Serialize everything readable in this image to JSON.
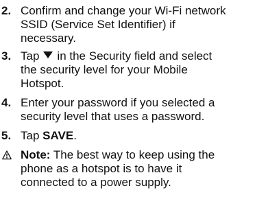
{
  "steps": [
    {
      "number": "2.",
      "lines": [
        "Confirm and change your Wi-Fi network",
        "SSID (Service Set Identifier) if",
        "necessary."
      ]
    },
    {
      "number": "3.",
      "before_icon": "Tap",
      "icon": "dropdown-triangle-icon",
      "after_icon": "in the Security field and select",
      "lines": [
        "the security level for your Mobile",
        "Hotspot."
      ]
    },
    {
      "number": "4.",
      "lines": [
        "Enter your password if you selected a",
        "security level that uses a password."
      ]
    },
    {
      "number": "5.",
      "prefix": "Tap ",
      "action": "SAVE",
      "suffix": "."
    }
  ],
  "note": {
    "icon": "warning-triangle-icon",
    "label": "Note:",
    "lines": [
      " The best way to keep using the",
      "phone as a hotspot is to have it",
      "connected to a power supply."
    ]
  }
}
